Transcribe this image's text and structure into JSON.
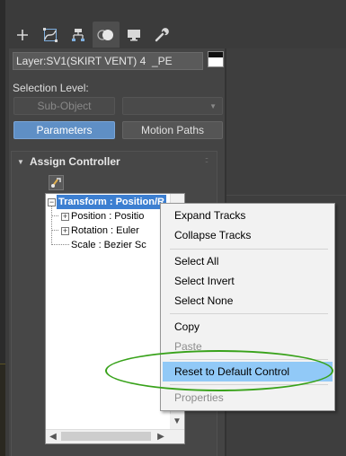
{
  "command_panel": {
    "tabs": [
      {
        "name": "create-tab",
        "icon": "plus-icon"
      },
      {
        "name": "modify-tab",
        "icon": "modify-curve-icon"
      },
      {
        "name": "hierarchy-tab",
        "icon": "hierarchy-icon"
      },
      {
        "name": "motion-tab",
        "icon": "motion-icon",
        "active": true
      },
      {
        "name": "display-tab",
        "icon": "monitor-icon"
      },
      {
        "name": "utilities-tab",
        "icon": "wrench-icon"
      }
    ],
    "object_name": "Layer:SV1(SKIRT VENT) 4  _PE",
    "object_color": "#ffffff"
  },
  "selection": {
    "label": "Selection Level:",
    "subobject_label": "Sub-Object",
    "dropdown_arrow": "▼",
    "parameters_label": "Parameters",
    "motion_paths_label": "Motion Paths"
  },
  "assign_controller": {
    "arrow": "▼",
    "title": "Assign Controller",
    "grip": "::",
    "tree": [
      {
        "label": "Transform : Position/R",
        "selected": true,
        "expander": "−"
      },
      {
        "label": "Position : Positio",
        "expander": "+"
      },
      {
        "label": "Rotation : Euler",
        "expander": "+"
      },
      {
        "label": "Scale : Bezier Sc"
      }
    ],
    "scroll_down": "▼",
    "scroll_left": "◀",
    "scroll_right": "▶"
  },
  "context_menu": {
    "items": [
      {
        "label": "Expand Tracks",
        "enabled": true
      },
      {
        "label": "Collapse Tracks",
        "enabled": true
      },
      {
        "label": "Select All",
        "enabled": true
      },
      {
        "label": "Select Invert",
        "enabled": true
      },
      {
        "label": "Select None",
        "enabled": true
      },
      {
        "label": "Copy",
        "enabled": true
      },
      {
        "label": "Paste",
        "enabled": false
      },
      {
        "label": "Reset to Default Control",
        "enabled": true,
        "highlighted": true
      },
      {
        "label": "Properties",
        "enabled": false
      }
    ]
  },
  "colors": {
    "accent": "#5f8fc5",
    "selection": "#3c7fd1",
    "menu_highlight": "#91c9f7",
    "annotation_ellipse": "#38a21a"
  }
}
